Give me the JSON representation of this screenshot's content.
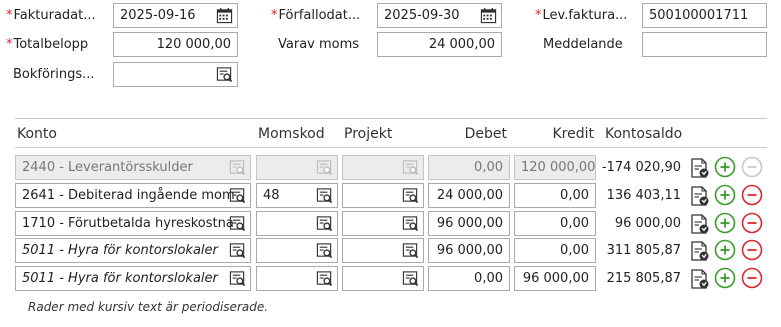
{
  "header": {
    "fakturadatum": {
      "label": "Fakturadat...",
      "value": "2025-09-16",
      "required": true
    },
    "forfallodatum": {
      "label": "Förfallodat...",
      "value": "2025-09-30",
      "required": true
    },
    "levfaktura": {
      "label": "Lev.faktura...",
      "value": "500100001711",
      "required": true
    },
    "totalbelopp": {
      "label": "Totalbelopp",
      "value": "120 000,00",
      "required": true
    },
    "varav_moms": {
      "label": "Varav moms",
      "value": "24 000,00"
    },
    "meddelande": {
      "label": "Meddelande",
      "value": ""
    },
    "bokforings": {
      "label": "Bokförings...",
      "value": ""
    }
  },
  "table": {
    "columns": {
      "konto": "Konto",
      "momskod": "Momskod",
      "projekt": "Projekt",
      "debet": "Debet",
      "kredit": "Kredit",
      "kontosaldo": "Kontosaldo"
    },
    "rows": [
      {
        "konto": "2440 - Leverantörsskulder",
        "momskod": "",
        "projekt": "",
        "debet": "0,00",
        "kredit": "120 000,00",
        "kontosaldo": "-174 020,90",
        "disabled": true,
        "italic": false
      },
      {
        "konto": "2641 - Debiterad ingående mom",
        "momskod": "48",
        "projekt": "",
        "debet": "24 000,00",
        "kredit": "0,00",
        "kontosaldo": "136 403,11",
        "disabled": false,
        "italic": false
      },
      {
        "konto": "1710 - Förutbetalda hyreskostna",
        "momskod": "",
        "projekt": "",
        "debet": "96 000,00",
        "kredit": "0,00",
        "kontosaldo": "96 000,00",
        "disabled": false,
        "italic": false
      },
      {
        "konto": "5011 - Hyra för kontorslokaler",
        "momskod": "",
        "projekt": "",
        "debet": "96 000,00",
        "kredit": "0,00",
        "kontosaldo": "311 805,87",
        "disabled": false,
        "italic": true
      },
      {
        "konto": "5011 - Hyra för kontorslokaler",
        "momskod": "",
        "projekt": "",
        "debet": "0,00",
        "kredit": "96 000,00",
        "kontosaldo": "215 805,87",
        "disabled": false,
        "italic": true
      }
    ]
  },
  "footer_note": "Rader med kursiv text är periodiserade.",
  "icons": {
    "calendar": "calendar-icon",
    "lookup": "lookup-icon",
    "document": "document-icon",
    "add": "add-row-icon",
    "remove": "remove-row-icon"
  },
  "colors": {
    "required": "#d9262e",
    "add": "#3a9a2a",
    "remove": "#d9262e",
    "disabled_bg": "#ececec"
  }
}
